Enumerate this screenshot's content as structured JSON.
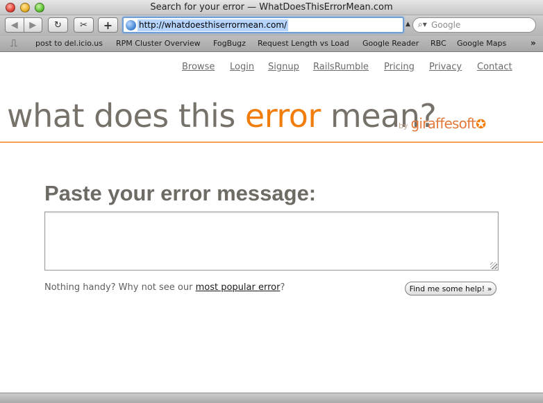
{
  "window": {
    "title": "Search for your error — WhatDoesThisErrorMean.com"
  },
  "toolbar": {
    "back_icon": "◀",
    "forward_icon": "▶",
    "reload_icon": "↻",
    "snapback_icon": "✂",
    "add_bookmark_icon": "+",
    "address_url": "http://whatdoesthiserrormean.com/",
    "search_placeholder": "Google",
    "search_icon": "⌕▾"
  },
  "bookmarks": {
    "book_icon": "⎍",
    "items": [
      "post to del.icio.us",
      "RPM Cluster Overview",
      "FogBugz",
      "Request Length vs Load",
      "Google Reader",
      "RBC",
      "Google Maps"
    ],
    "overflow_icon": "»"
  },
  "site_nav": {
    "items": [
      "Browse",
      "Login",
      "Signup",
      "RailsRumble",
      "Pricing",
      "Privacy",
      "Contact"
    ]
  },
  "logo": {
    "part1": "what does this ",
    "accent": "error",
    "part2": " mean?",
    "by": "by",
    "brand": "giraffesoft",
    "star": "✪",
    "accent_color": "#f07d0c",
    "text_color": "#76726a"
  },
  "main": {
    "heading": "Paste your error message:",
    "textarea_value": "",
    "hint_prefix": "Nothing handy? Why not see our ",
    "hint_link": "most popular error",
    "hint_suffix": "?",
    "submit_label": "Find me some help! »"
  }
}
